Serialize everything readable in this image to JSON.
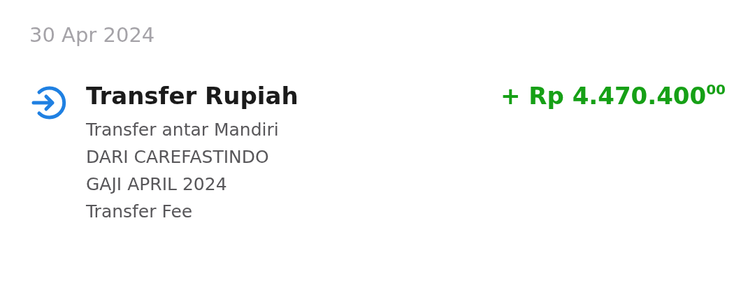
{
  "date": "30 Apr 2024",
  "transaction": {
    "title": "Transfer Rupiah",
    "amount": "+ Rp 4.470.400$^{00}$",
    "details": [
      "Transfer antar Mandiri",
      "DARI CAREFASTINDO",
      "GAJI APRIL 2024",
      "Transfer Fee"
    ]
  }
}
